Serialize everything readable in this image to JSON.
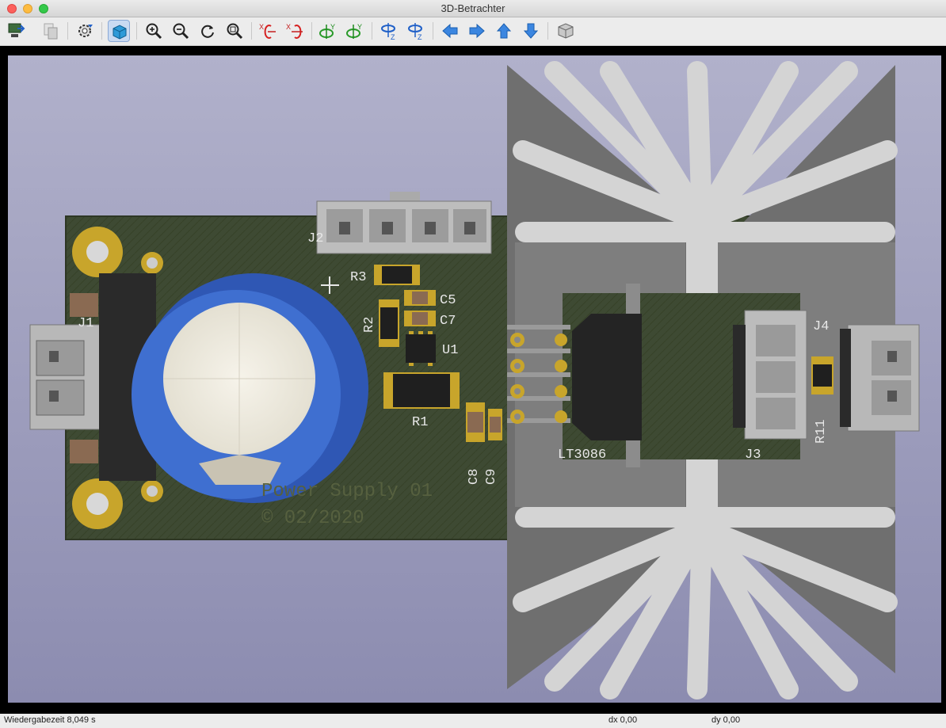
{
  "window": {
    "title": "3D-Betrachter"
  },
  "toolbar": {
    "buttons": [
      {
        "name": "reload-board-button",
        "icon": "reload-board-icon"
      },
      {
        "name": "copy-image-button",
        "icon": "copy-icon"
      },
      {
        "name": "display-options-button",
        "icon": "gear-icon"
      },
      {
        "name": "raytracing-toggle-button",
        "icon": "cube-icon",
        "active": true
      },
      {
        "name": "zoom-in-button",
        "icon": "zoom-in-icon"
      },
      {
        "name": "zoom-out-button",
        "icon": "zoom-out-icon"
      },
      {
        "name": "redraw-button",
        "icon": "refresh-icon"
      },
      {
        "name": "zoom-fit-button",
        "icon": "zoom-fit-icon"
      },
      {
        "name": "rotate-x-cw-button",
        "icon": "rotate-x-icon",
        "label": "X"
      },
      {
        "name": "rotate-x-ccw-button",
        "icon": "rotate-x-icon",
        "label": "X"
      },
      {
        "name": "rotate-y-cw-button",
        "icon": "rotate-y-icon",
        "label": "Y"
      },
      {
        "name": "rotate-y-ccw-button",
        "icon": "rotate-y-icon",
        "label": "Y"
      },
      {
        "name": "rotate-z-cw-button",
        "icon": "rotate-z-icon",
        "label": "Z"
      },
      {
        "name": "rotate-z-ccw-button",
        "icon": "rotate-z-icon",
        "label": "Z"
      },
      {
        "name": "move-left-button",
        "icon": "arrow-left-icon"
      },
      {
        "name": "move-right-button",
        "icon": "arrow-right-icon"
      },
      {
        "name": "move-up-button",
        "icon": "arrow-up-icon"
      },
      {
        "name": "move-down-button",
        "icon": "arrow-down-icon"
      },
      {
        "name": "toggle-orthographic-button",
        "icon": "ortho-cube-icon"
      }
    ]
  },
  "scene": {
    "silkscreen": {
      "j1": "J1",
      "j2": "J2",
      "j3": "J3",
      "j4": "J4",
      "r1": "R1",
      "r2": "R2",
      "r3": "R3",
      "r11": "R11",
      "c5": "C5",
      "c7": "C7",
      "c8": "C8",
      "c9": "C9",
      "u1": "U1",
      "lt": "LT3086",
      "line1": "Power Supply 01",
      "line2": "© 02/2020"
    },
    "colors": {
      "background_top": "#b1b1cb",
      "background_bottom": "#8c8cb0",
      "pcb": "#3e4a33",
      "silk": "#e8e8e8",
      "pad_gold": "#c8a52b",
      "capacitor_blue": "#3f6fd0",
      "heatsink": "#d4d4d4"
    }
  },
  "status": {
    "render_time": "Wiedergabezeit 8,049 s",
    "dx": "dx 0,00",
    "dy": "dy 0,00"
  }
}
